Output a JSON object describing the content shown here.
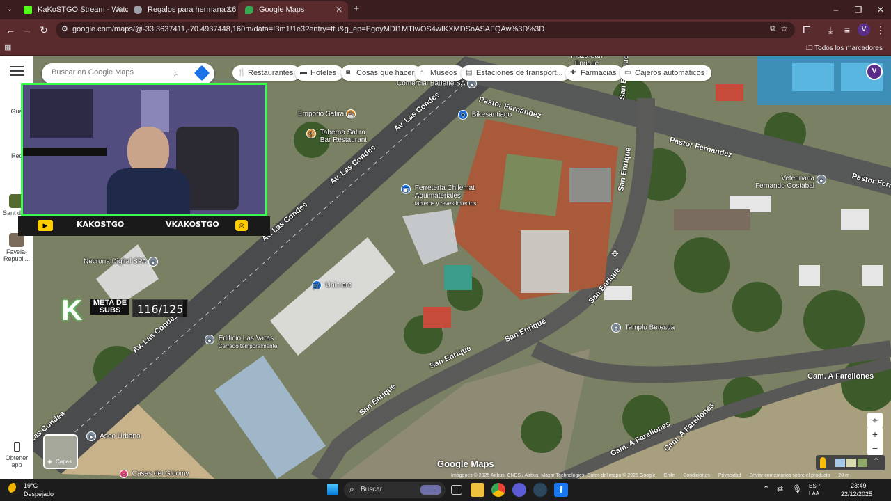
{
  "browser": {
    "tabs": [
      {
        "title": "KaKoSTGO Stream - Watch Live",
        "color": "#53fc18"
      },
      {
        "title": "Regalos para hermana 16",
        "color": "#9aa0a6"
      },
      {
        "title": "Google Maps",
        "color": "#34a853"
      }
    ],
    "url": "google.com/maps/@-33.3637411,-70.4937448,160m/data=!3m1!1e3?entry=ttu&g_ep=EgoyMDI1MTIwOS4wIKXMDSoASAFQAw%3D%3D",
    "bookmarks_all": "Todos los marcadores"
  },
  "rail": {
    "items": [
      "Gua",
      "Rec",
      "Sant de C",
      "Favela-Repúbli...",
      "Obtener app"
    ]
  },
  "search": {
    "placeholder": "Buscar en Google Maps"
  },
  "chips": [
    {
      "label": "Restaurantes",
      "icon": "fork-knife-icon"
    },
    {
      "label": "Hoteles",
      "icon": "bed-icon"
    },
    {
      "label": "Cosas que hacer",
      "icon": "camera-icon"
    },
    {
      "label": "Museos",
      "icon": "museum-icon"
    },
    {
      "label": "Estaciones de transport...",
      "icon": "transit-icon"
    },
    {
      "label": "Farmacias",
      "icon": "pharmacy-icon"
    },
    {
      "label": "Cajeros automáticos",
      "icon": "atm-icon"
    }
  ],
  "stream": {
    "social_left": "KAKOSTGO",
    "social_right": "VKAKOSTGO",
    "goal_label": "META DE SUBS",
    "goal_value": "116/125",
    "goal_progress": 0.928
  },
  "map": {
    "roads": {
      "pastor1": "Pastor Fernández",
      "pastor2": "Pastor Fernández",
      "pastor3": "Pastor Fernánd",
      "condes1": "Av. Las Condes",
      "condes2": "Av. Las Condes",
      "condes3": "Av. Las Condes",
      "condes4": "Av. Las Condes",
      "condes5": "Las Condes",
      "enrique1": "San Enrique",
      "enrique2": "San Enrique",
      "enrique3": "San Enrique",
      "enrique4": "San Enrique",
      "enrique5": "San Enrique",
      "enrique6": "San Enrique",
      "farellones1": "Cam. A Farellones",
      "farellones2": "Cam. A Farellones",
      "farellones3": "Cam. A Farellones",
      "plaza": "Plaza San Enrique"
    },
    "pois": {
      "comercial": "Comercial Bauerle SA",
      "emporio": "Emporio Satira",
      "taberna": "Taberna Satira Bar Restaurant",
      "bike": "Bikesantiago",
      "ferreteria": "Ferretería Chilemat Aquimateriales",
      "ferreteria_sub": "tableros y revestimientos",
      "veterinaria": "Veterinaria Fernando Costabal",
      "necrona": "Necrona Digital SPA",
      "unimarc": "Unimarc",
      "edificio": "Edificio Las Varas",
      "edificio_sub": "Cerrado temporalmente",
      "templo": "Templo Betesda",
      "aseo": "Aseo Urbano",
      "casas": "Casas del Gloomy"
    },
    "layers_label": "Capas",
    "watermark": "Google Maps",
    "attribution": "Imágenes © 2025 Airbus, CNES / Airbus, Maxar Technologies, Datos del mapa © 2025 Google",
    "attribution_links": [
      "Chile",
      "Condiciones",
      "Privacidad",
      "Enviar comentarios sobre el producto"
    ],
    "scale": "20 m"
  },
  "taskbar": {
    "temp": "19°C",
    "weather": "Despejado",
    "search_label": "Buscar",
    "lang": "ESP",
    "lang_sub": "LAA",
    "time": "23:49",
    "date": "22/12/2025"
  }
}
